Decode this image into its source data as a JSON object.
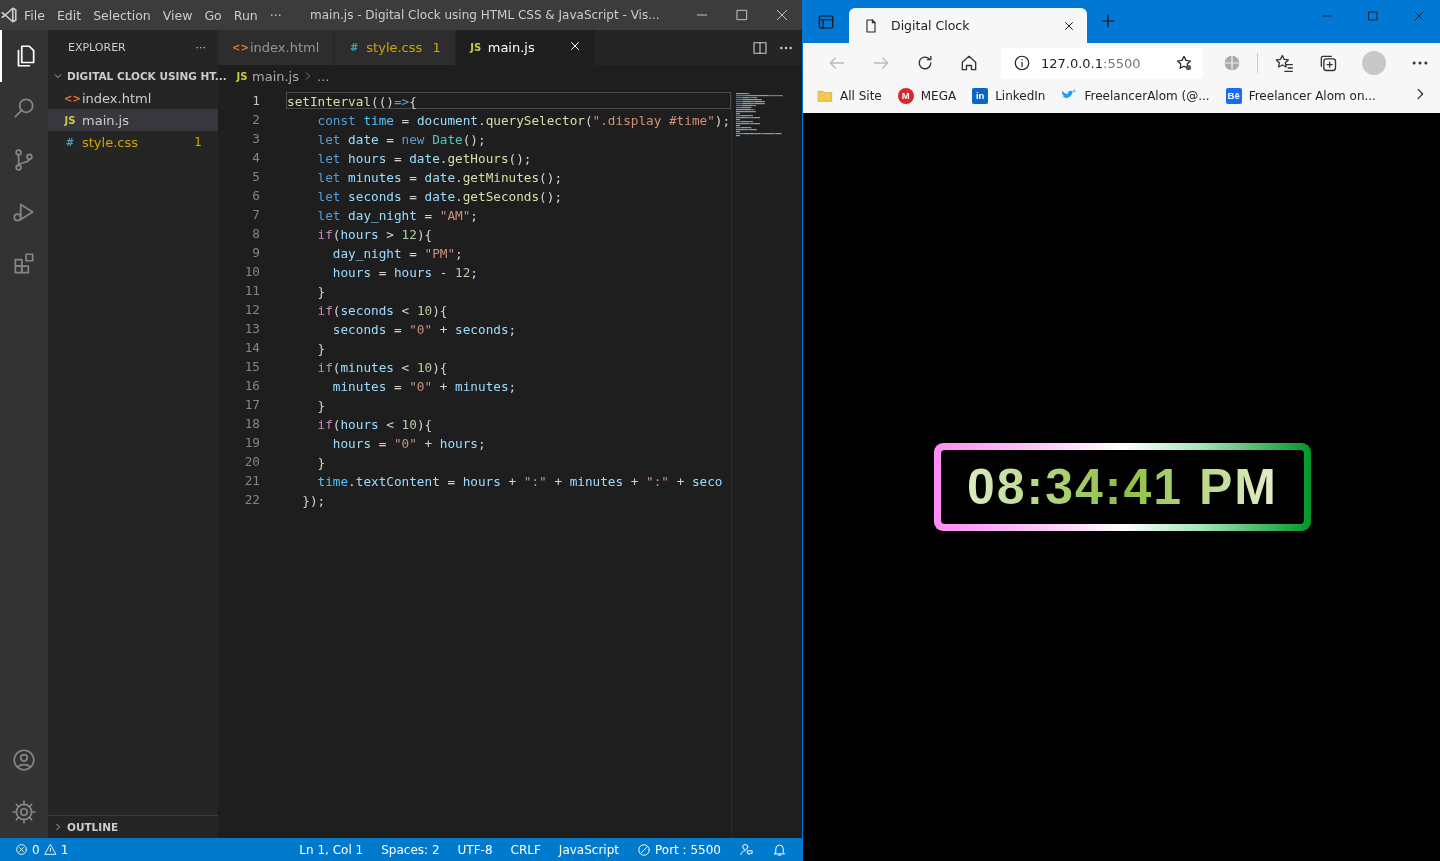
{
  "vscode": {
    "title": "main.js - Digital Clock using HTML CSS & JavaScript - Vis...",
    "menu": [
      "File",
      "Edit",
      "Selection",
      "View",
      "Go",
      "Run",
      "···"
    ],
    "activity": [
      {
        "kind": "files",
        "selected": true
      },
      {
        "kind": "search",
        "selected": false
      },
      {
        "kind": "scm",
        "selected": false
      },
      {
        "kind": "run",
        "selected": false
      },
      {
        "kind": "extensions",
        "selected": false
      }
    ],
    "explorer": {
      "title": "EXPLORER",
      "more": "···",
      "folder": {
        "label": "DIGITAL CLOCK USING HT...",
        "expanded": true
      },
      "files": [
        {
          "name": "index.html",
          "glyph": "<>",
          "kind": "html",
          "selected": false
        },
        {
          "name": "main.js",
          "glyph": "JS",
          "kind": "js",
          "selected": true
        },
        {
          "name": "style.css",
          "glyph": "#",
          "kind": "css",
          "selected": false,
          "problems": "1"
        }
      ],
      "outline": {
        "label": "OUTLINE",
        "expanded": false
      }
    },
    "tabs": [
      {
        "label": "index.html",
        "glyph": "<>",
        "kind": "html",
        "selected": false
      },
      {
        "label": "style.css",
        "glyph": "#",
        "kind": "css",
        "selected": false,
        "problems": "1"
      },
      {
        "label": "main.js",
        "glyph": "JS",
        "kind": "js",
        "selected": true
      }
    ],
    "breadcrumb": {
      "glyph": "JS",
      "file": "main.js",
      "rest": "..."
    },
    "code": [
      {
        "number": "1",
        "current": true,
        "tokens": [
          {
            "kind": "fn",
            "text": "setInterval"
          },
          {
            "kind": "p",
            "text": "(()"
          },
          {
            "kind": "kw",
            "text": "=>"
          },
          {
            "kind": "p",
            "text": "{"
          }
        ]
      },
      {
        "number": "2",
        "current": false,
        "tokens": [
          {
            "kind": "kw",
            "text": "    const "
          },
          {
            "kind": "const",
            "text": "time"
          },
          {
            "kind": "p",
            "text": " = "
          },
          {
            "kind": "var",
            "text": "document"
          },
          {
            "kind": "p",
            "text": "."
          },
          {
            "kind": "fn",
            "text": "querySelector"
          },
          {
            "kind": "p",
            "text": "("
          },
          {
            "kind": "str",
            "text": "\".display #time\""
          },
          {
            "kind": "p",
            "text": ");"
          }
        ]
      },
      {
        "number": "3",
        "current": false,
        "tokens": [
          {
            "kind": "kw",
            "text": "    let "
          },
          {
            "kind": "var",
            "text": "date"
          },
          {
            "kind": "p",
            "text": " = "
          },
          {
            "kind": "kw",
            "text": "new "
          },
          {
            "kind": "cls",
            "text": "Date"
          },
          {
            "kind": "p",
            "text": "();"
          }
        ]
      },
      {
        "number": "4",
        "current": false,
        "tokens": [
          {
            "kind": "kw",
            "text": "    let "
          },
          {
            "kind": "var",
            "text": "hours"
          },
          {
            "kind": "p",
            "text": " = "
          },
          {
            "kind": "var",
            "text": "date"
          },
          {
            "kind": "p",
            "text": "."
          },
          {
            "kind": "fn",
            "text": "getHours"
          },
          {
            "kind": "p",
            "text": "();"
          }
        ]
      },
      {
        "number": "5",
        "current": false,
        "tokens": [
          {
            "kind": "kw",
            "text": "    let "
          },
          {
            "kind": "var",
            "text": "minutes"
          },
          {
            "kind": "p",
            "text": " = "
          },
          {
            "kind": "var",
            "text": "date"
          },
          {
            "kind": "p",
            "text": "."
          },
          {
            "kind": "fn",
            "text": "getMinutes"
          },
          {
            "kind": "p",
            "text": "();"
          }
        ]
      },
      {
        "number": "6",
        "current": false,
        "tokens": [
          {
            "kind": "kw",
            "text": "    let "
          },
          {
            "kind": "var",
            "text": "seconds"
          },
          {
            "kind": "p",
            "text": " = "
          },
          {
            "kind": "var",
            "text": "date"
          },
          {
            "kind": "p",
            "text": "."
          },
          {
            "kind": "fn",
            "text": "getSeconds"
          },
          {
            "kind": "p",
            "text": "();"
          }
        ]
      },
      {
        "number": "7",
        "current": false,
        "tokens": [
          {
            "kind": "kw",
            "text": "    let "
          },
          {
            "kind": "var",
            "text": "day_night"
          },
          {
            "kind": "p",
            "text": " = "
          },
          {
            "kind": "str",
            "text": "\"AM\""
          },
          {
            "kind": "p",
            "text": ";"
          }
        ]
      },
      {
        "number": "8",
        "current": false,
        "tokens": [
          {
            "kind": "ctrl",
            "text": "    if"
          },
          {
            "kind": "p",
            "text": "("
          },
          {
            "kind": "var",
            "text": "hours"
          },
          {
            "kind": "p",
            "text": " > "
          },
          {
            "kind": "num",
            "text": "12"
          },
          {
            "kind": "p",
            "text": "){"
          }
        ]
      },
      {
        "number": "9",
        "current": false,
        "tokens": [
          {
            "kind": "var",
            "text": "      day_night"
          },
          {
            "kind": "p",
            "text": " = "
          },
          {
            "kind": "str",
            "text": "\"PM\""
          },
          {
            "kind": "p",
            "text": ";"
          }
        ]
      },
      {
        "number": "10",
        "current": false,
        "tokens": [
          {
            "kind": "var",
            "text": "      hours"
          },
          {
            "kind": "p",
            "text": " = "
          },
          {
            "kind": "var",
            "text": "hours"
          },
          {
            "kind": "p",
            "text": " - "
          },
          {
            "kind": "num",
            "text": "12"
          },
          {
            "kind": "p",
            "text": ";"
          }
        ]
      },
      {
        "number": "11",
        "current": false,
        "tokens": [
          {
            "kind": "p",
            "text": "    }"
          }
        ]
      },
      {
        "number": "12",
        "current": false,
        "tokens": [
          {
            "kind": "ctrl",
            "text": "    if"
          },
          {
            "kind": "p",
            "text": "("
          },
          {
            "kind": "var",
            "text": "seconds"
          },
          {
            "kind": "p",
            "text": " < "
          },
          {
            "kind": "num",
            "text": "10"
          },
          {
            "kind": "p",
            "text": "){"
          }
        ]
      },
      {
        "number": "13",
        "current": false,
        "tokens": [
          {
            "kind": "var",
            "text": "      seconds"
          },
          {
            "kind": "p",
            "text": " = "
          },
          {
            "kind": "str",
            "text": "\"0\""
          },
          {
            "kind": "p",
            "text": " + "
          },
          {
            "kind": "var",
            "text": "seconds"
          },
          {
            "kind": "p",
            "text": ";"
          }
        ]
      },
      {
        "number": "14",
        "current": false,
        "tokens": [
          {
            "kind": "p",
            "text": "    }"
          }
        ]
      },
      {
        "number": "15",
        "current": false,
        "tokens": [
          {
            "kind": "ctrl",
            "text": "    if"
          },
          {
            "kind": "p",
            "text": "("
          },
          {
            "kind": "var",
            "text": "minutes"
          },
          {
            "kind": "p",
            "text": " < "
          },
          {
            "kind": "num",
            "text": "10"
          },
          {
            "kind": "p",
            "text": "){"
          }
        ]
      },
      {
        "number": "16",
        "current": false,
        "tokens": [
          {
            "kind": "var",
            "text": "      minutes"
          },
          {
            "kind": "p",
            "text": " = "
          },
          {
            "kind": "str",
            "text": "\"0\""
          },
          {
            "kind": "p",
            "text": " + "
          },
          {
            "kind": "var",
            "text": "minutes"
          },
          {
            "kind": "p",
            "text": ";"
          }
        ]
      },
      {
        "number": "17",
        "current": false,
        "tokens": [
          {
            "kind": "p",
            "text": "    }"
          }
        ]
      },
      {
        "number": "18",
        "current": false,
        "tokens": [
          {
            "kind": "ctrl",
            "text": "    if"
          },
          {
            "kind": "p",
            "text": "("
          },
          {
            "kind": "var",
            "text": "hours"
          },
          {
            "kind": "p",
            "text": " < "
          },
          {
            "kind": "num",
            "text": "10"
          },
          {
            "kind": "p",
            "text": "){"
          }
        ]
      },
      {
        "number": "19",
        "current": false,
        "tokens": [
          {
            "kind": "var",
            "text": "      hours"
          },
          {
            "kind": "p",
            "text": " = "
          },
          {
            "kind": "str",
            "text": "\"0\""
          },
          {
            "kind": "p",
            "text": " + "
          },
          {
            "kind": "var",
            "text": "hours"
          },
          {
            "kind": "p",
            "text": ";"
          }
        ]
      },
      {
        "number": "20",
        "current": false,
        "tokens": [
          {
            "kind": "p",
            "text": "    }"
          }
        ]
      },
      {
        "number": "21",
        "current": false,
        "tokens": [
          {
            "kind": "const",
            "text": "    time"
          },
          {
            "kind": "p",
            "text": "."
          },
          {
            "kind": "var",
            "text": "textContent"
          },
          {
            "kind": "p",
            "text": " = "
          },
          {
            "kind": "var",
            "text": "hours"
          },
          {
            "kind": "p",
            "text": " + "
          },
          {
            "kind": "str",
            "text": "\":\""
          },
          {
            "kind": "p",
            "text": " + "
          },
          {
            "kind": "var",
            "text": "minutes"
          },
          {
            "kind": "p",
            "text": " + "
          },
          {
            "kind": "str",
            "text": "\":\""
          },
          {
            "kind": "p",
            "text": " + "
          },
          {
            "kind": "var",
            "text": "seco"
          }
        ]
      },
      {
        "number": "22",
        "current": false,
        "tokens": [
          {
            "kind": "p",
            "text": "  });"
          }
        ]
      }
    ],
    "status": {
      "errors": "0",
      "warnings": "1",
      "items": [
        "Ln 1, Col 1",
        "Spaces: 2",
        "UTF-8",
        "CRLF",
        "JavaScript"
      ],
      "port": "Port : 5500"
    }
  },
  "browser": {
    "tab": {
      "title": "Digital Clock"
    },
    "address": {
      "host": "127.0.0.1",
      "port": ":5500"
    },
    "bookmarks": [
      {
        "kind": "folder",
        "label": "All Site"
      },
      {
        "kind": "mega",
        "glyph": "M",
        "label": "MEGA"
      },
      {
        "kind": "linkedin",
        "glyph": "in",
        "label": "LinkedIn"
      },
      {
        "kind": "twitter",
        "label": "FreelancerAlom (@..."
      },
      {
        "kind": "behance",
        "glyph": "Bē",
        "label": "Freelancer Alom on..."
      }
    ],
    "clock": {
      "time": "08:34:41 PM"
    }
  }
}
